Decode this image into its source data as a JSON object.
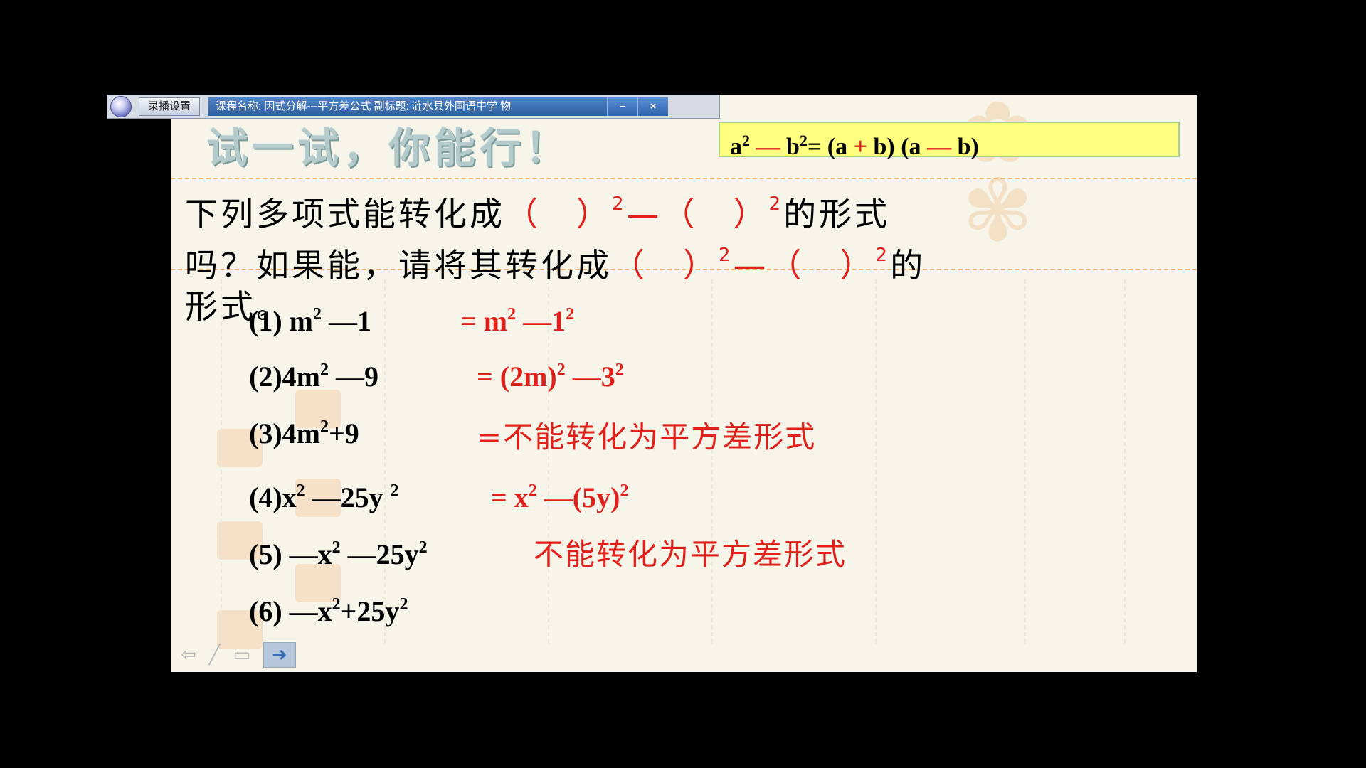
{
  "toolbar": {
    "settings_label": "录播设置",
    "info_text": "课程名称: 因式分解---平方差公式    副标题: 涟水县外国语中学    物",
    "minimize_label": "–",
    "close_label": "×"
  },
  "slide": {
    "title": "试一试，你能行！",
    "formula": {
      "p1": "a",
      "p2": "2",
      "p3": " — ",
      "p4": "b",
      "p5": "2",
      "p6": "= (a ",
      "p7": "+",
      "p8": " b) (a ",
      "p9": "—",
      "p10": " b)"
    },
    "question": {
      "l1a": "下列多项式能转化成",
      "l1b": "（　）",
      "l1c": "2",
      "l1d": "—（　）",
      "l1e": "2",
      "l1f": "的形式",
      "l2a": "吗？如果能，请将其转化成",
      "l2b": "（　）",
      "l2c": "2",
      "l2d": "—（　）",
      "l2e": "2",
      "l2f": "的",
      "l3": "形式。"
    },
    "items": [
      {
        "q1": "(1)  m",
        "q2": "2",
        "q3": " —1",
        "a1": "=   m",
        "a2": "2",
        "a3": " —1",
        "a4": "2"
      },
      {
        "q1": "(2)4m",
        "q2": "2",
        "q3": " —9",
        "a1": "= (2m)",
        "a2": "2",
        "a3": " —3",
        "a4": "2"
      },
      {
        "q1": "(3)4m",
        "q2": "2",
        "q3": "+9",
        "a1": "=不能转化为平方差形式"
      },
      {
        "q1": "(4)x",
        "q2": "2",
        "q3": " —25y ",
        "q4": "2",
        "a1": "=   x",
        "a2": "2",
        "a3": " —(5y)",
        "a4": "2"
      },
      {
        "q1": "(5) —x",
        "q2": "2",
        "q3": " —25y",
        "q4": "2",
        "a1": "不能转化为平方差形式"
      },
      {
        "q1": "(6) —x",
        "q2": "2",
        "q3": "+25y",
        "q4": "2"
      }
    ]
  },
  "colors": {
    "answer": "#e0201b",
    "formula_bg": "#ffff80",
    "slide_bg": "#f7f5e9"
  }
}
